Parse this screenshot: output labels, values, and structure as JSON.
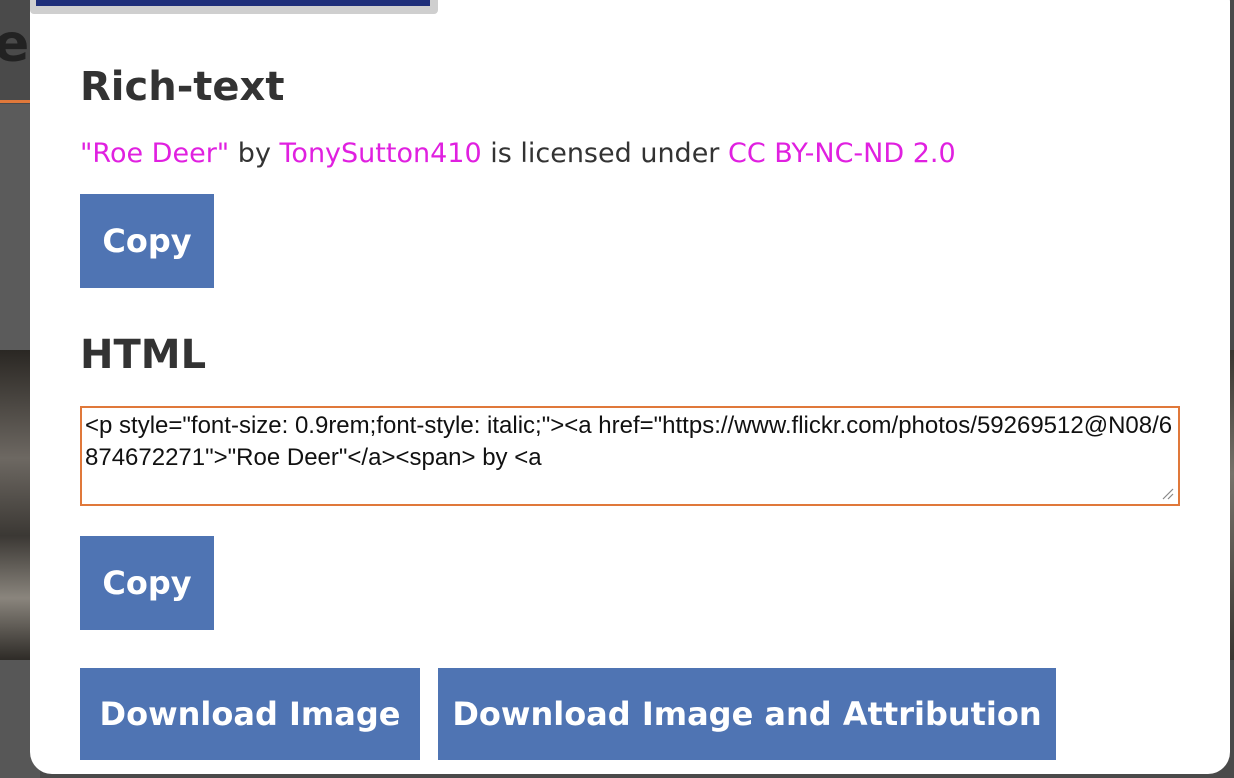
{
  "background": {
    "title_fragment": "ee"
  },
  "modal": {
    "rich_text": {
      "heading": "Rich-text",
      "title_link": "\"Roe Deer\"",
      "by_text": " by ",
      "author_link": "TonySutton410",
      "licensed_text": " is licensed under ",
      "license_link": "CC BY-NC-ND 2.0",
      "copy_label": "Copy"
    },
    "html": {
      "heading": "HTML",
      "code": "<p style=\"font-size: 0.9rem;font-style: italic;\"><a href=\"https://www.flickr.com/photos/59269512@N08/6874672271\">\"Roe Deer\"</a><span> by <a",
      "copy_label": "Copy"
    },
    "download_image_label": "Download Image",
    "download_attribution_label": "Download Image and Attribution"
  },
  "colors": {
    "link": "#e020e0",
    "button": "#4f74b3",
    "textarea_border": "#e0783a"
  }
}
